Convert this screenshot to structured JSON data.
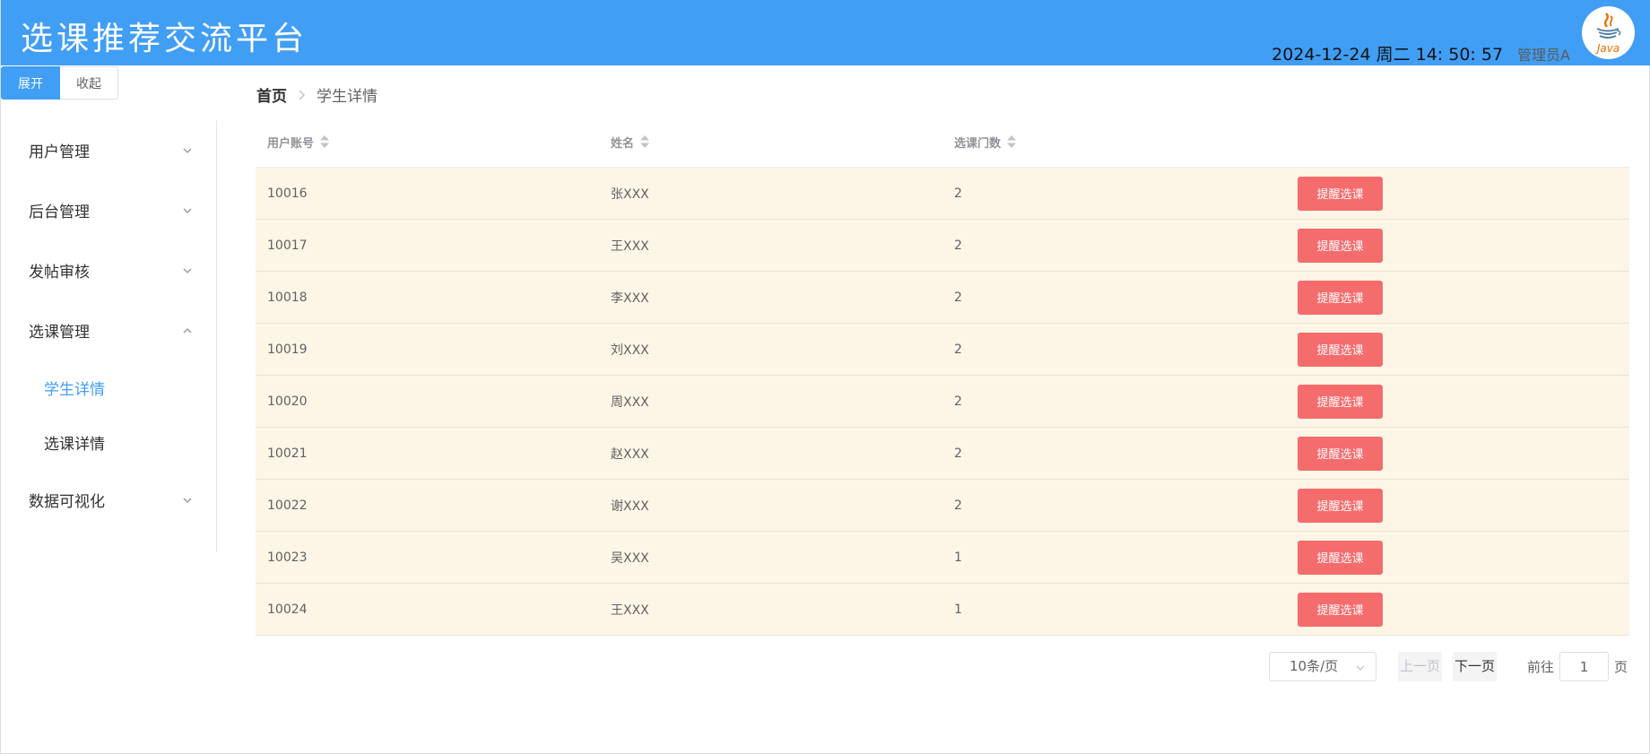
{
  "header": {
    "title": "选课推荐交流平台",
    "datetime": "2024-12-24 周二 14: 50: 57",
    "user": "管理员A",
    "logo_icon": "java-logo-icon",
    "logo_text": "Java",
    "colors": {
      "bar": "#409EF5",
      "logo_red": "#E76F00",
      "logo_blue": "#5382A1"
    }
  },
  "toggle": {
    "expand": "展开",
    "collapse": "收起"
  },
  "sidebar": {
    "items": [
      {
        "label": "用户管理",
        "icon": "chevron-down-icon"
      },
      {
        "label": "后台管理",
        "icon": "chevron-down-icon"
      },
      {
        "label": "发帖审核",
        "icon": "chevron-down-icon"
      },
      {
        "label": "选课管理",
        "icon": "chevron-up-icon",
        "children": [
          {
            "label": "学生详情",
            "active": true
          },
          {
            "label": "选课详情",
            "active": false
          }
        ]
      },
      {
        "label": "数据可视化",
        "icon": "chevron-down-icon"
      }
    ]
  },
  "breadcrumb": {
    "home": "首页",
    "current": "学生详情"
  },
  "table": {
    "columns": [
      "用户账号",
      "姓名",
      "选课门数"
    ],
    "action_label": "提醒选课",
    "rows": [
      {
        "account": "10016",
        "name": "张XXX",
        "count": "2"
      },
      {
        "account": "10017",
        "name": "王XXX",
        "count": "2"
      },
      {
        "account": "10018",
        "name": "李XXX",
        "count": "2"
      },
      {
        "account": "10019",
        "name": "刘XXX",
        "count": "2"
      },
      {
        "account": "10020",
        "name": "周XXX",
        "count": "2"
      },
      {
        "account": "10021",
        "name": "赵XXX",
        "count": "2"
      },
      {
        "account": "10022",
        "name": "谢XXX",
        "count": "2"
      },
      {
        "account": "10023",
        "name": "吴XXX",
        "count": "1"
      },
      {
        "account": "10024",
        "name": "王XXX",
        "count": "1"
      }
    ],
    "colors": {
      "row_bg": "#FDF5E6",
      "action": "#F56C6C"
    }
  },
  "pagination": {
    "page_size": "10条/页",
    "prev": "上一页",
    "next": "下一页",
    "goto_label": "前往",
    "goto_value": "1",
    "goto_suffix": "页"
  }
}
